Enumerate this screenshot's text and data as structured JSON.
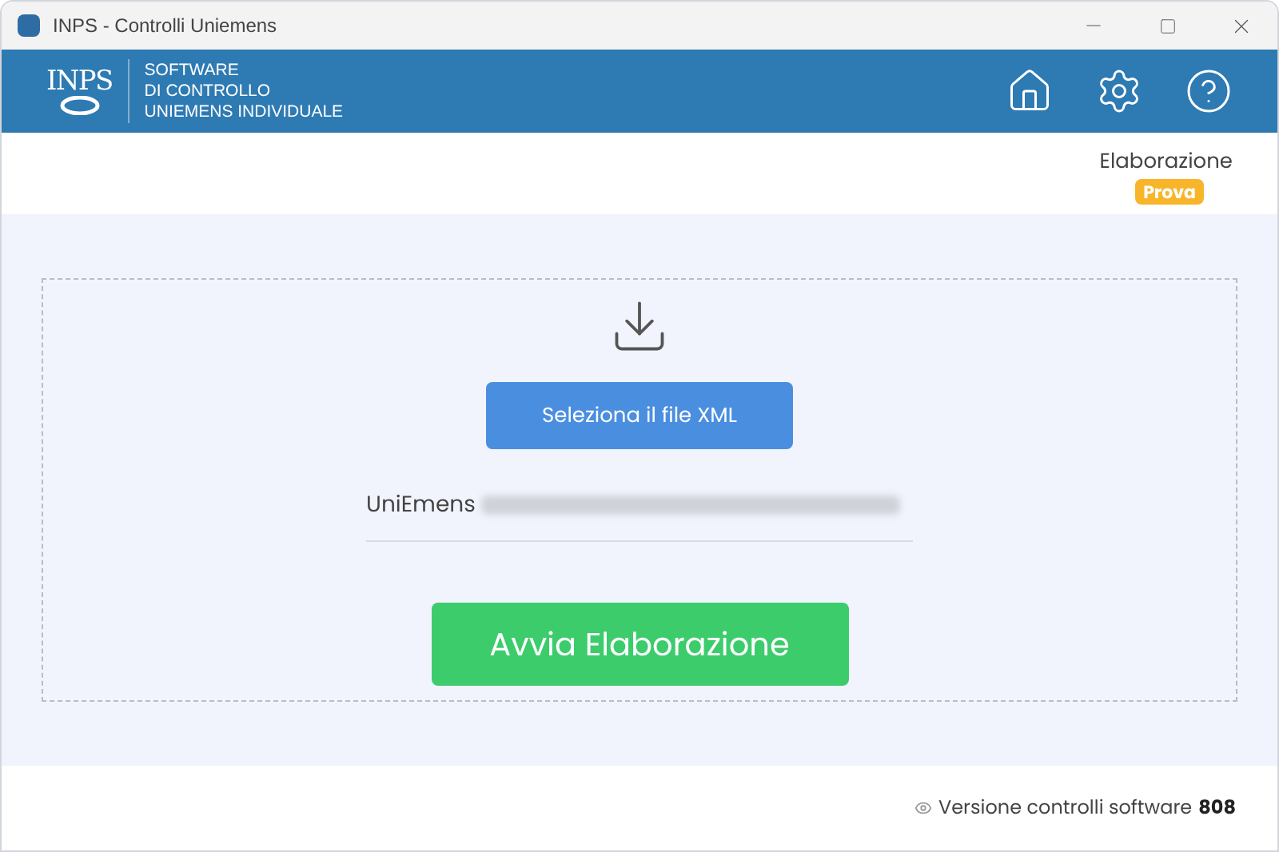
{
  "window": {
    "title": "INPS - Controlli Uniemens"
  },
  "header": {
    "logo": "INPS",
    "subtitle_lines": [
      "SOFTWARE",
      "DI CONTROLLO",
      "UNIEMENS INDIVIDUALE"
    ]
  },
  "status": {
    "label": "Elaborazione",
    "badge": "Prova"
  },
  "upload": {
    "select_button": "Seleziona il file XML",
    "file_name": "UniEmens",
    "start_button": "Avvia Elaborazione"
  },
  "footer": {
    "text": "Versione controlli software",
    "version": "808"
  }
}
